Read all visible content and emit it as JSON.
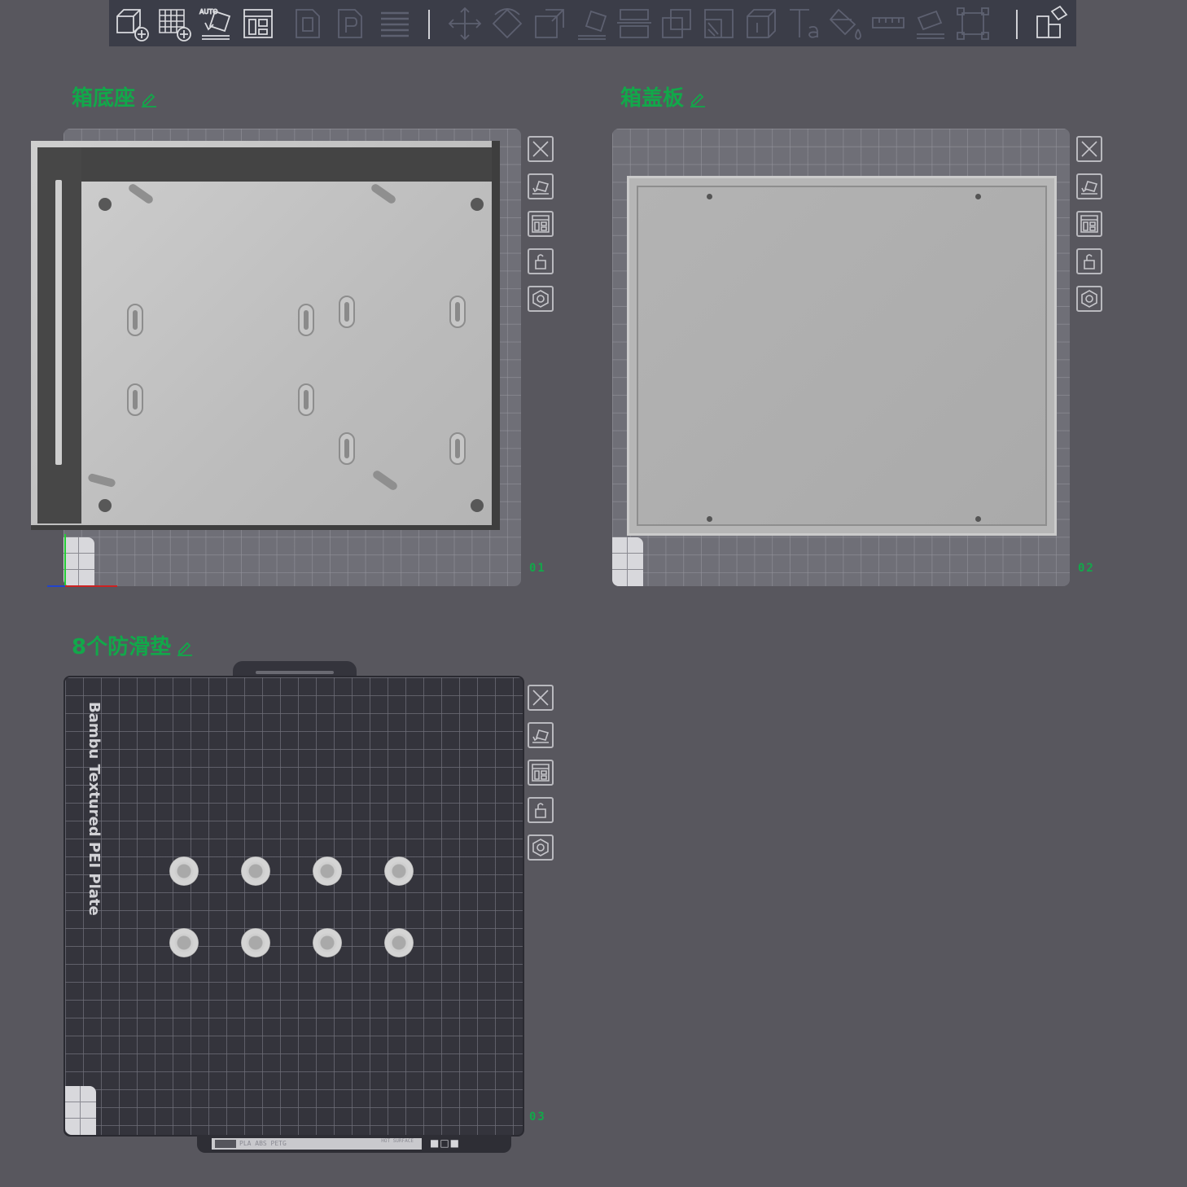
{
  "toolbar": {
    "items": [
      {
        "name": "add-object-icon"
      },
      {
        "name": "add-plate-icon"
      },
      {
        "name": "auto-orient-icon",
        "label": "AUTO"
      },
      {
        "name": "arrange-icon"
      },
      {
        "name": "split-objects-icon"
      },
      {
        "name": "split-parts-icon"
      },
      {
        "name": "layers-icon"
      },
      {
        "name": "move-icon"
      },
      {
        "name": "rotate-icon"
      },
      {
        "name": "scale-icon"
      },
      {
        "name": "lay-on-face-icon"
      },
      {
        "name": "cut-icon"
      },
      {
        "name": "boolean-icon"
      },
      {
        "name": "support-paint-icon"
      },
      {
        "name": "seam-paint-icon"
      },
      {
        "name": "text-icon"
      },
      {
        "name": "color-paint-icon"
      },
      {
        "name": "measure-icon"
      },
      {
        "name": "assemble-icon"
      },
      {
        "name": "variable-height-icon"
      },
      {
        "name": "assembly-view-icon"
      }
    ]
  },
  "plates": [
    {
      "id": "plate-1",
      "name": "箱底座",
      "number": "01"
    },
    {
      "id": "plate-2",
      "name": "箱盖板",
      "number": "02"
    },
    {
      "id": "plate-3",
      "name": "8个防滑垫",
      "number": "03",
      "bed_label": "Bambu Textured PEI Plate",
      "bed_strip": "PLA ABS PETG",
      "bed_note": "HOT SURFACE"
    }
  ],
  "side_buttons": [
    {
      "name": "remove-plate-icon"
    },
    {
      "name": "auto-orient-plate-icon"
    },
    {
      "name": "arrange-plate-icon"
    },
    {
      "name": "lock-plate-icon"
    },
    {
      "name": "plate-settings-icon"
    }
  ],
  "colors": {
    "background": "#58575e",
    "toolbar": "#3b3d48",
    "accent_green": "#12a84a",
    "plate_grey": "#6f6f77",
    "pei_plate": "#34343c"
  }
}
